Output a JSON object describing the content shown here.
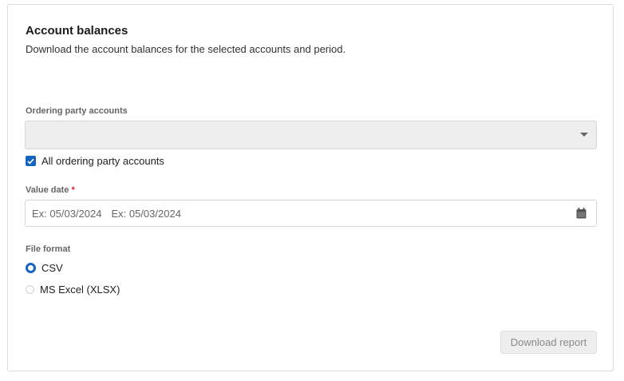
{
  "header": {
    "title": "Account balances",
    "subtitle": "Download the account balances for the selected accounts and period."
  },
  "ordering_accounts": {
    "label": "Ordering party accounts",
    "selected": "",
    "all_label": "All ordering party accounts",
    "all_checked": true
  },
  "value_date": {
    "label": "Value date",
    "required_mark": "*",
    "from_placeholder": "Ex: 05/03/2024",
    "to_placeholder": "Ex: 05/03/2024"
  },
  "file_format": {
    "label": "File format",
    "options": [
      {
        "label": "CSV",
        "selected": true
      },
      {
        "label": "MS Excel (XLSX)",
        "selected": false
      }
    ]
  },
  "actions": {
    "download_label": "Download report",
    "download_enabled": false
  },
  "colors": {
    "accent": "#1565c0",
    "required": "#c62828",
    "disabled_bg": "#eeeeee"
  }
}
